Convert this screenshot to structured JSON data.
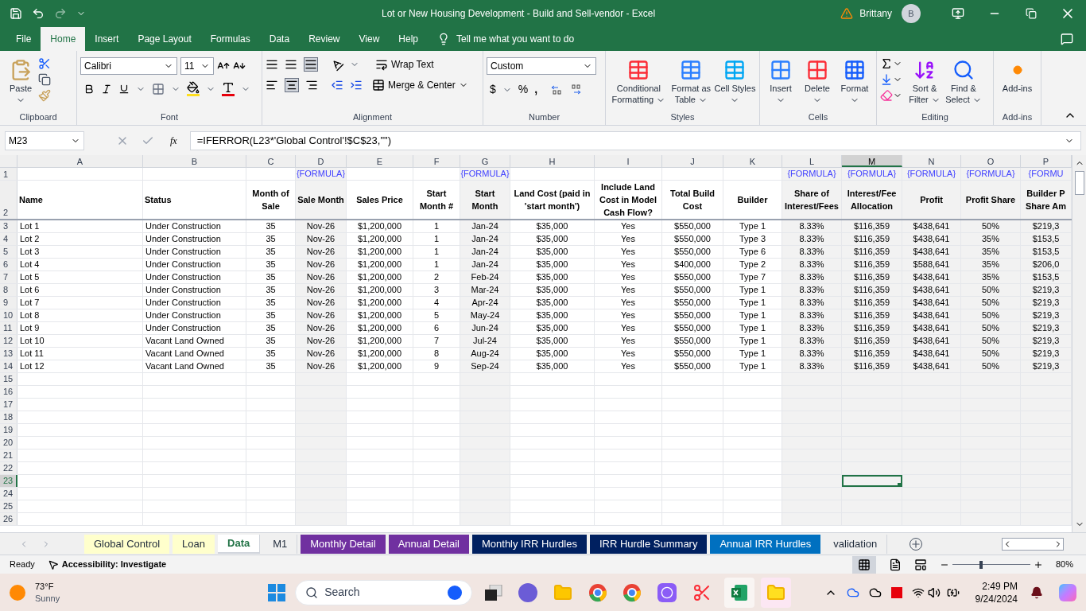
{
  "window": {
    "title": "Lot or New Housing Development - Build and Sell-vendor  -  Excel",
    "user": "Brittany",
    "avatar": "B"
  },
  "ribbon_tabs": [
    {
      "label": "File",
      "selected": false
    },
    {
      "label": "Home",
      "selected": true
    },
    {
      "label": "Insert",
      "selected": false
    },
    {
      "label": "Page Layout",
      "selected": false
    },
    {
      "label": "Formulas",
      "selected": false
    },
    {
      "label": "Data",
      "selected": false
    },
    {
      "label": "Review",
      "selected": false
    },
    {
      "label": "View",
      "selected": false
    },
    {
      "label": "Help",
      "selected": false
    }
  ],
  "tell_me": "Tell me what you want to do",
  "ribbon": {
    "paste": "Paste",
    "font_name": "Calibri",
    "font_size": "11",
    "wrap_text": "Wrap Text",
    "merge_center": "Merge & Center",
    "number_format": "Custom",
    "currency": "$",
    "percent": "%",
    "comma": ",",
    "conditional_formatting": "Conditional Formatting",
    "format_as_table": "Format as Table",
    "cell_styles": "Cell Styles",
    "insert": "Insert",
    "delete": "Delete",
    "format": "Format",
    "sort_filter": "Sort & Filter",
    "find_select": "Find & Select",
    "add_ins": "Add-ins",
    "groups": [
      "Clipboard",
      "Font",
      "Alignment",
      "Number",
      "Styles",
      "Cells",
      "Editing",
      "Add-ins"
    ]
  },
  "formula_bar": {
    "name_box": "M23",
    "fx": "fx",
    "formula": "=IFERROR(L23*'Global Control'!$C$23,\"\")"
  },
  "grid": {
    "header_rows": [
      "1",
      "2"
    ],
    "columns": [
      {
        "letter": "A",
        "selected": false,
        "header": "Name"
      },
      {
        "letter": "B",
        "selected": false,
        "header": "Status"
      },
      {
        "letter": "C",
        "selected": false,
        "header": "Month of Sale"
      },
      {
        "letter": "D",
        "selected": false,
        "note": "{FORMULA}",
        "header": "Sale Month"
      },
      {
        "letter": "E",
        "selected": false,
        "header": "Sales Price"
      },
      {
        "letter": "F",
        "selected": false,
        "header": "Start Month #"
      },
      {
        "letter": "G",
        "selected": false,
        "note": "{FORMULA}",
        "header": "Start Month"
      },
      {
        "letter": "H",
        "selected": false,
        "header": "Land Cost (paid in 'start month')"
      },
      {
        "letter": "I",
        "selected": false,
        "header": "Include Land Cost in Model Cash Flow?"
      },
      {
        "letter": "J",
        "selected": false,
        "header": "Total Build Cost"
      },
      {
        "letter": "K",
        "selected": false,
        "header": "Builder"
      },
      {
        "letter": "L",
        "selected": false,
        "note": "{FORMULA}",
        "header": "Share of Interest/Fees"
      },
      {
        "letter": "M",
        "selected": true,
        "note": "{FORMULA}",
        "header": "Interest/Fee Allocation"
      },
      {
        "letter": "N",
        "selected": false,
        "note": "{FORMULA}",
        "header": "Profit"
      },
      {
        "letter": "O",
        "selected": false,
        "note": "{FORMULA}",
        "header": "Profit Share"
      },
      {
        "letter": "P",
        "selected": false,
        "note": "{FORMU",
        "header": "Builder P\nShare Am"
      }
    ],
    "rows": [
      {
        "number": "3",
        "selected": false,
        "cells": [
          "Lot 1",
          "Under Construction",
          "35",
          "Nov-26",
          "$1,200,000",
          "1",
          "Jan-24",
          "$35,000",
          "Yes",
          "$550,000",
          "Type 1",
          "8.33%",
          "$116,359",
          "$438,641",
          "50%",
          "$219,3"
        ]
      },
      {
        "number": "4",
        "selected": false,
        "cells": [
          "Lot 2",
          "Under Construction",
          "35",
          "Nov-26",
          "$1,200,000",
          "1",
          "Jan-24",
          "$35,000",
          "Yes",
          "$550,000",
          "Type 3",
          "8.33%",
          "$116,359",
          "$438,641",
          "35%",
          "$153,5"
        ]
      },
      {
        "number": "5",
        "selected": false,
        "cells": [
          "Lot 3",
          "Under Construction",
          "35",
          "Nov-26",
          "$1,200,000",
          "1",
          "Jan-24",
          "$35,000",
          "Yes",
          "$550,000",
          "Type 6",
          "8.33%",
          "$116,359",
          "$438,641",
          "35%",
          "$153,5"
        ]
      },
      {
        "number": "6",
        "selected": false,
        "cells": [
          "Lot 4",
          "Under Construction",
          "35",
          "Nov-26",
          "$1,200,000",
          "1",
          "Jan-24",
          "$35,000",
          "Yes",
          "$400,000",
          "Type 2",
          "8.33%",
          "$116,359",
          "$588,641",
          "35%",
          "$206,0"
        ]
      },
      {
        "number": "7",
        "selected": false,
        "cells": [
          "Lot 5",
          "Under Construction",
          "35",
          "Nov-26",
          "$1,200,000",
          "2",
          "Feb-24",
          "$35,000",
          "Yes",
          "$550,000",
          "Type 7",
          "8.33%",
          "$116,359",
          "$438,641",
          "35%",
          "$153,5"
        ]
      },
      {
        "number": "8",
        "selected": false,
        "cells": [
          "Lot 6",
          "Under Construction",
          "35",
          "Nov-26",
          "$1,200,000",
          "3",
          "Mar-24",
          "$35,000",
          "Yes",
          "$550,000",
          "Type 1",
          "8.33%",
          "$116,359",
          "$438,641",
          "50%",
          "$219,3"
        ]
      },
      {
        "number": "9",
        "selected": false,
        "cells": [
          "Lot 7",
          "Under Construction",
          "35",
          "Nov-26",
          "$1,200,000",
          "4",
          "Apr-24",
          "$35,000",
          "Yes",
          "$550,000",
          "Type 1",
          "8.33%",
          "$116,359",
          "$438,641",
          "50%",
          "$219,3"
        ]
      },
      {
        "number": "10",
        "selected": false,
        "cells": [
          "Lot 8",
          "Under Construction",
          "35",
          "Nov-26",
          "$1,200,000",
          "5",
          "May-24",
          "$35,000",
          "Yes",
          "$550,000",
          "Type 1",
          "8.33%",
          "$116,359",
          "$438,641",
          "50%",
          "$219,3"
        ]
      },
      {
        "number": "11",
        "selected": false,
        "cells": [
          "Lot 9",
          "Under Construction",
          "35",
          "Nov-26",
          "$1,200,000",
          "6",
          "Jun-24",
          "$35,000",
          "Yes",
          "$550,000",
          "Type 1",
          "8.33%",
          "$116,359",
          "$438,641",
          "50%",
          "$219,3"
        ]
      },
      {
        "number": "12",
        "selected": false,
        "cells": [
          "Lot 10",
          "Vacant Land Owned",
          "35",
          "Nov-26",
          "$1,200,000",
          "7",
          "Jul-24",
          "$35,000",
          "Yes",
          "$550,000",
          "Type 1",
          "8.33%",
          "$116,359",
          "$438,641",
          "50%",
          "$219,3"
        ]
      },
      {
        "number": "13",
        "selected": false,
        "cells": [
          "Lot 11",
          "Vacant Land Owned",
          "35",
          "Nov-26",
          "$1,200,000",
          "8",
          "Aug-24",
          "$35,000",
          "Yes",
          "$550,000",
          "Type 1",
          "8.33%",
          "$116,359",
          "$438,641",
          "50%",
          "$219,3"
        ]
      },
      {
        "number": "14",
        "selected": false,
        "cells": [
          "Lot 12",
          "Vacant Land Owned",
          "35",
          "Nov-26",
          "$1,200,000",
          "9",
          "Sep-24",
          "$35,000",
          "Yes",
          "$550,000",
          "Type 1",
          "8.33%",
          "$116,359",
          "$438,641",
          "50%",
          "$219,3"
        ]
      },
      {
        "number": "15",
        "selected": false
      },
      {
        "number": "16",
        "selected": false
      },
      {
        "number": "17",
        "selected": false
      },
      {
        "number": "18",
        "selected": false
      },
      {
        "number": "19",
        "selected": false
      },
      {
        "number": "20",
        "selected": false
      },
      {
        "number": "21",
        "selected": false
      },
      {
        "number": "22",
        "selected": false
      },
      {
        "number": "23",
        "selected": true
      },
      {
        "number": "24",
        "selected": false
      },
      {
        "number": "25",
        "selected": false
      },
      {
        "number": "26",
        "selected": false
      }
    ]
  },
  "sheet_tabs": [
    {
      "label": "Global Control",
      "selected": false,
      "color": "#ffffcc"
    },
    {
      "label": "Loan",
      "selected": false,
      "color": "#ffffcc"
    },
    {
      "label": "Data",
      "selected": true
    },
    {
      "label": "M1",
      "selected": false
    },
    {
      "label": "Monthly Detail",
      "selected": false,
      "color": "#7030a0"
    },
    {
      "label": "Annual Detail",
      "selected": false,
      "color": "#7030a0"
    },
    {
      "label": "Monthly IRR Hurdles",
      "selected": false,
      "color": "#002060"
    },
    {
      "label": "IRR Hurdle Summary",
      "selected": false,
      "color": "#002060"
    },
    {
      "label": "Annual IRR Hurdles",
      "selected": false,
      "color": "#0070c0"
    },
    {
      "label": "validation",
      "selected": false
    }
  ],
  "status_bar": {
    "mode": "Ready",
    "accessibility": "Accessibility: Investigate",
    "zoom": {
      "level": 0.37,
      "reading": "80%"
    }
  },
  "taskbar": {
    "temperature": "73°F",
    "weather": "Sunny",
    "search": "Search",
    "time": "2:49 PM",
    "date": "9/24/2024"
  }
}
